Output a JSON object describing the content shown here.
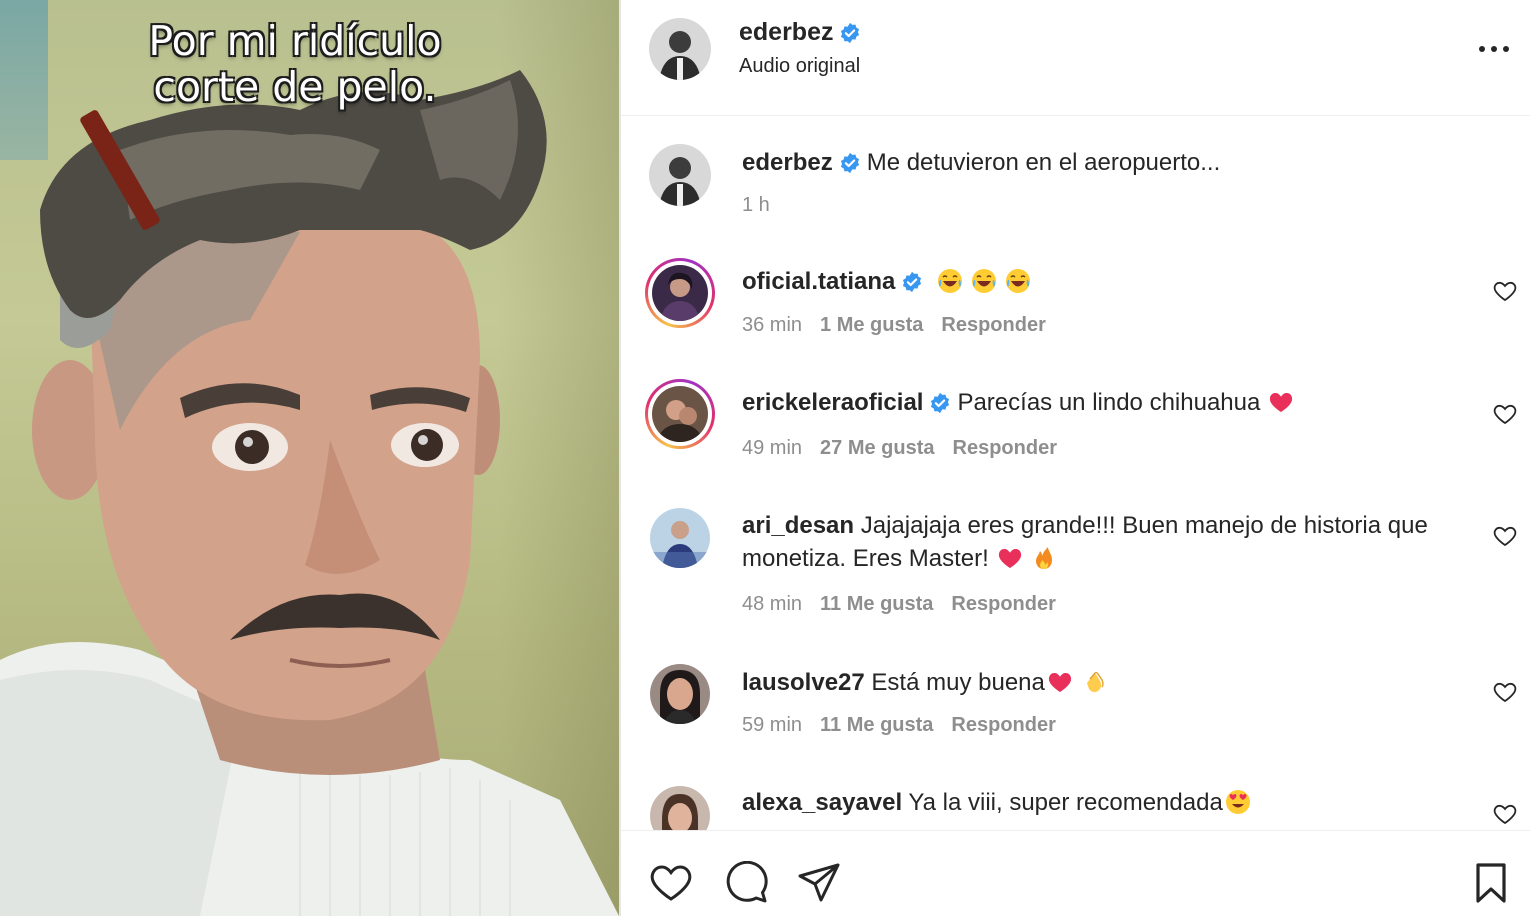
{
  "media": {
    "caption_line1": "Por mi ridículo",
    "caption_line2": "corte de pelo.",
    "image_subject": "man-with-odd-haircut-photo"
  },
  "header": {
    "username": "ederbez",
    "subtitle": "Audio original",
    "verified": true,
    "more_icon": "more-horizontal-icon"
  },
  "post_caption": {
    "username": "ederbez",
    "verified": true,
    "text": "Me detuvieron en el aeropuerto...",
    "time": "1 h"
  },
  "comments": [
    {
      "username": "oficial.tatiana",
      "verified": true,
      "text": "",
      "emojis": [
        "laughing-emoji",
        "laughing-emoji",
        "laughing-emoji"
      ],
      "time": "36 min",
      "likes": "1 Me gusta",
      "reply": "Responder",
      "story_ring": true
    },
    {
      "username": "erickeleraoficial",
      "verified": true,
      "text": "Parecías un lindo chihuahua",
      "emojis": [
        "heart-emoji"
      ],
      "time": "49 min",
      "likes": "27 Me gusta",
      "reply": "Responder",
      "story_ring": true
    },
    {
      "username": "ari_desan",
      "verified": false,
      "text": "Jajajajaja eres grande!!! Buen manejo de historia que monetiza. Eres Master!",
      "emojis": [
        "heart-emoji",
        "fire-emoji"
      ],
      "time": "48 min",
      "likes": "11 Me gusta",
      "reply": "Responder",
      "story_ring": false
    },
    {
      "username": "lausolve27",
      "verified": false,
      "text": "Está muy buena",
      "emojis": [
        "heart-emoji",
        "clap-emoji"
      ],
      "time": "59 min",
      "likes": "11 Me gusta",
      "reply": "Responder",
      "story_ring": false
    },
    {
      "username": "alexa_sayavel",
      "verified": false,
      "text": "Ya la viii, super recomendada",
      "emojis": [
        "heart-eyes-emoji"
      ],
      "time": "",
      "likes": "",
      "reply": "",
      "story_ring": false
    }
  ],
  "actions": {
    "like_icon": "heart-outline-icon",
    "comment_icon": "comment-bubble-icon",
    "share_icon": "paper-plane-icon",
    "save_icon": "bookmark-icon"
  },
  "colors": {
    "verified_blue": "#3897f0",
    "text_primary": "#262626",
    "text_secondary": "#8e8e8e",
    "heart_emoji": "#e8305b"
  }
}
